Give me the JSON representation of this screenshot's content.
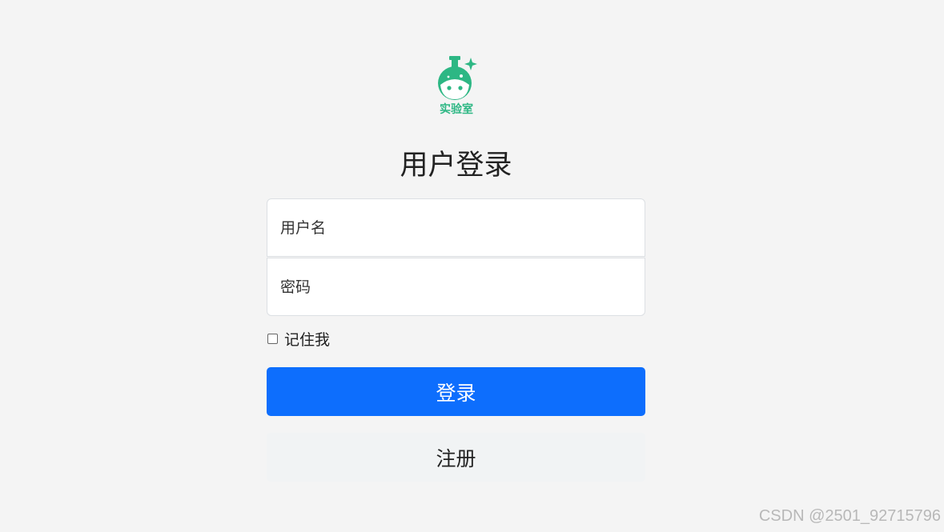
{
  "logo": {
    "icon": "flask-face-icon",
    "text": "实验室",
    "color": "#2db784"
  },
  "form": {
    "title": "用户登录",
    "username_placeholder": "用户名",
    "password_placeholder": "密码",
    "remember_label": "记住我",
    "remember_checked": false,
    "login_label": "登录",
    "register_label": "注册"
  },
  "colors": {
    "primary": "#0d6efd",
    "background": "#f4f4f4"
  },
  "watermark": "CSDN @2501_92715796"
}
